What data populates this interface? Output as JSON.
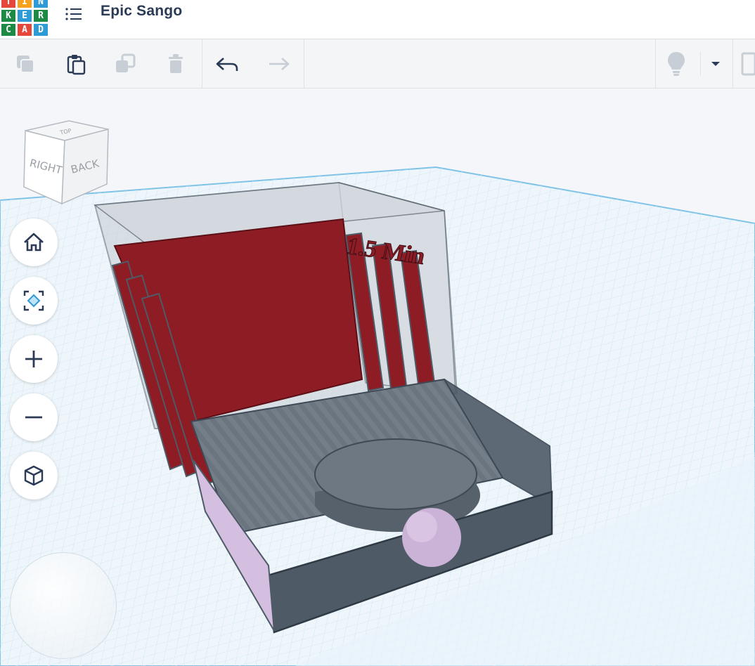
{
  "app": {
    "logo_letters": [
      "T",
      "I",
      "N",
      "K",
      "E",
      "R",
      "C",
      "A",
      "D"
    ],
    "logo_colors": [
      "#e5483a",
      "#f6a21e",
      "#2e9bd6",
      "#1c8a45",
      "#2e9bd6",
      "#1c8a45",
      "#1c8a45",
      "#e5483a",
      "#2e9bd6"
    ],
    "project_title": "Epic Sango"
  },
  "toolbar": {
    "buttons": [
      "copy",
      "paste",
      "duplicate",
      "delete",
      "undo",
      "redo"
    ],
    "right_controls": [
      "lightbulb",
      "dropdown",
      "notes"
    ]
  },
  "view_cube": {
    "faces": {
      "top": "TOP",
      "left": "RIGHT",
      "right": "BACK"
    }
  },
  "nav_controls": [
    "home",
    "fit-view",
    "zoom-in",
    "zoom-out",
    "perspective"
  ],
  "scene": {
    "text_label": "1.5 Min",
    "colors": {
      "red_panel": "#8e1c25",
      "glass": "#c6ccd3",
      "dark_shape": "#4e5a66",
      "lavender": "#d5bfe0",
      "grid": "#cfe6f2",
      "grid_edge": "#7ec3e6"
    }
  }
}
